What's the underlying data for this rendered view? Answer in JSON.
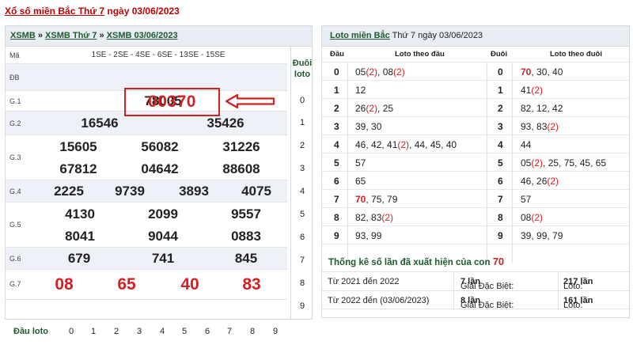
{
  "title": {
    "prefix": "Xổ số miền Bắc Thứ 7",
    "suffix": " ngày ",
    "date": "03/06/2023"
  },
  "left": {
    "breadcrumb": [
      "XSMB",
      "XSMB Thứ 7",
      "XSMB 03/06/2023"
    ],
    "breadcrumb_sep": " » ",
    "ma_label": "Mã",
    "ma_value": "1SE - 2SE - 4SE - 6SE - 13SE - 15SE",
    "prizes": [
      {
        "label": "ĐB",
        "numbers": [
          "00370"
        ]
      },
      {
        "label": "G.1",
        "numbers": [
          "78005"
        ]
      },
      {
        "label": "G.2",
        "numbers": [
          "16546",
          "35426"
        ]
      },
      {
        "label": "G.3",
        "numbers": [
          "15605",
          "56082",
          "31226",
          "67812",
          "04642",
          "88608"
        ]
      },
      {
        "label": "G.4",
        "numbers": [
          "2225",
          "9739",
          "3893",
          "4075"
        ]
      },
      {
        "label": "G.5",
        "numbers": [
          "4130",
          "2099",
          "9557",
          "8041",
          "9044",
          "0883"
        ]
      },
      {
        "label": "G.6",
        "numbers": [
          "679",
          "741",
          "845"
        ]
      },
      {
        "label": "G.7",
        "numbers": [
          "08",
          "65",
          "40",
          "83"
        ]
      }
    ],
    "duoi_loto_header": [
      "Đuôi",
      "loto"
    ],
    "duoi_digits": [
      "0",
      "1",
      "2",
      "3",
      "4",
      "5",
      "6",
      "7",
      "8",
      "9"
    ],
    "dau_loto_label": "Đầu loto",
    "dau_digits": [
      "0",
      "1",
      "2",
      "3",
      "4",
      "5",
      "6",
      "7",
      "8",
      "9"
    ]
  },
  "right": {
    "header": {
      "link": "Loto miền Bắc",
      "text": " Thứ 7 ngày 03/06/2023"
    },
    "col_headers": {
      "dau": "Đầu",
      "loto_dau": "Loto theo đầu",
      "duoi": "Đuôi",
      "loto_duoi": "Loto theo đuôi"
    },
    "rows": [
      {
        "d": "0",
        "v": [
          [
            "05",
            ""
          ],
          [
            "(2)",
            "r"
          ],
          [
            ", 08",
            ""
          ],
          [
            "(2)",
            "r"
          ]
        ],
        "d2": "0",
        "v2": [
          [
            "70",
            "rb"
          ],
          [
            ", 30, 40",
            ""
          ]
        ]
      },
      {
        "d": "1",
        "v": [
          [
            "12",
            ""
          ]
        ],
        "d2": "1",
        "v2": [
          [
            "41",
            ""
          ],
          [
            "(2)",
            "r"
          ]
        ]
      },
      {
        "d": "2",
        "v": [
          [
            "26",
            ""
          ],
          [
            "(2)",
            "r"
          ],
          [
            ", 25",
            ""
          ]
        ],
        "d2": "2",
        "v2": [
          [
            "82, 12, 42",
            ""
          ]
        ]
      },
      {
        "d": "3",
        "v": [
          [
            "39, 30",
            ""
          ]
        ],
        "d2": "3",
        "v2": [
          [
            "93, 83",
            ""
          ],
          [
            "(2)",
            "r"
          ]
        ]
      },
      {
        "d": "4",
        "v": [
          [
            "46, 42, 41",
            ""
          ],
          [
            "(2)",
            "r"
          ],
          [
            ", 44, 45, 40",
            ""
          ]
        ],
        "d2": "4",
        "v2": [
          [
            "44",
            ""
          ]
        ]
      },
      {
        "d": "5",
        "v": [
          [
            "57",
            ""
          ]
        ],
        "d2": "5",
        "v2": [
          [
            "05",
            ""
          ],
          [
            "(2)",
            "r"
          ],
          [
            ", 25, 75, 45, 65",
            ""
          ]
        ]
      },
      {
        "d": "6",
        "v": [
          [
            "65",
            ""
          ]
        ],
        "d2": "6",
        "v2": [
          [
            "46, 26",
            ""
          ],
          [
            "(2)",
            "r"
          ]
        ]
      },
      {
        "d": "7",
        "v": [
          [
            "70",
            "rb"
          ],
          [
            ", 75, 79",
            ""
          ]
        ],
        "d2": "7",
        "v2": [
          [
            "57",
            ""
          ]
        ]
      },
      {
        "d": "8",
        "v": [
          [
            "82, 83",
            ""
          ],
          [
            "(2)",
            "r"
          ]
        ],
        "d2": "8",
        "v2": [
          [
            "08",
            ""
          ],
          [
            "(2)",
            "r"
          ]
        ]
      },
      {
        "d": "9",
        "v": [
          [
            "93, 99",
            ""
          ]
        ],
        "d2": "9",
        "v2": [
          [
            "39, 99, 79",
            ""
          ]
        ]
      }
    ],
    "stats": {
      "title": "Thống kê số lần đã xuất hiện của con ",
      "number": "70",
      "rows": [
        {
          "period": "Từ 2021 đến 2022",
          "gdb_label": "Giải Đặc Biệt: ",
          "gdb_value": "7 lần",
          "loto_label": "Loto: ",
          "loto_value": "217 lần"
        },
        {
          "period": "Từ 2022 đến (03/06/2023)",
          "gdb_label": "Giải Đặc Biệt: ",
          "gdb_value": "8 lần",
          "loto_label": "Loto: ",
          "loto_value": "161 lần"
        }
      ]
    }
  },
  "colors": {
    "accent_red": "#d42020",
    "link_green": "#1d5a2e",
    "row_alt": "#eef1f8"
  }
}
